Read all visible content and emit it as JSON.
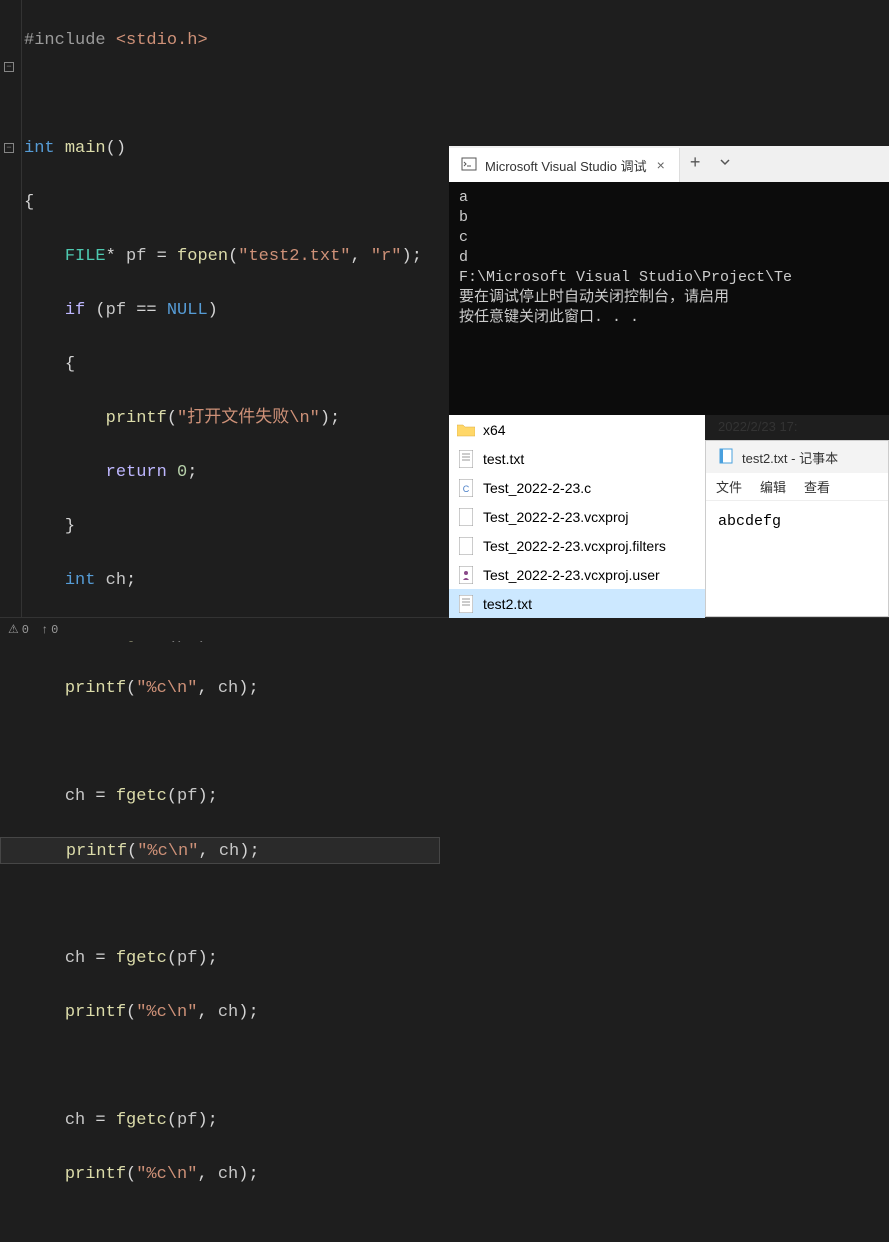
{
  "code": {
    "include_pp": "#include",
    "include_hdr": " <stdio.h>",
    "int": "int",
    "main": "main",
    "parens_empty": "()",
    "brace_open": "{",
    "brace_close": "}",
    "indent1": "    ",
    "indent2": "        ",
    "FILE": "FILE",
    "star": "* ",
    "pf": "pf",
    "eq": " = ",
    "fopen": "fopen",
    "str_test2": "\"test2.txt\"",
    "comma_sp": ", ",
    "str_r": "\"r\"",
    "paren_close_semi": ");",
    "if": "if",
    "cond_open": " (",
    "eqeq": " == ",
    "NULL": "NULL",
    "paren_close": ")",
    "printf": "printf",
    "paren_open": "(",
    "str_openfail": "\"打开文件失败\\n\"",
    "return": "return",
    "zero": " 0",
    "semi": ";",
    "int_kw": "int",
    "ch": " ch",
    "ch_var": "ch",
    "ch_eq": " = ",
    "fgetc": "fgetc",
    "str_fmtc": "\"%c\\n\"",
    "paren_open_only": "("
  },
  "statusbar": {
    "warn_icon": "⚠",
    "warn_count": "0",
    "up_icon": "↑",
    "up_count": "0"
  },
  "console": {
    "tab_title": "Microsoft Visual Studio 调试",
    "output_lines": [
      "a",
      "b",
      "c",
      "d",
      "",
      "F:\\Microsoft Visual Studio\\Project\\Te",
      "要在调试停止时自动关闭控制台，请启用",
      "按任意键关闭此窗口. . ."
    ]
  },
  "explorer": {
    "date": "2022/2/23 17:",
    "items": [
      {
        "name": "x64",
        "type": "folder"
      },
      {
        "name": "test.txt",
        "type": "txt"
      },
      {
        "name": "Test_2022-2-23.c",
        "type": "c"
      },
      {
        "name": "Test_2022-2-23.vcxproj",
        "type": "proj"
      },
      {
        "name": "Test_2022-2-23.vcxproj.filters",
        "type": "file"
      },
      {
        "name": "Test_2022-2-23.vcxproj.user",
        "type": "user"
      },
      {
        "name": "test2.txt",
        "type": "txt",
        "selected": true
      }
    ]
  },
  "notepad": {
    "title": "test2.txt - 记事本",
    "menu": [
      "文件",
      "编辑",
      "查看"
    ],
    "content": "abcdefg"
  }
}
